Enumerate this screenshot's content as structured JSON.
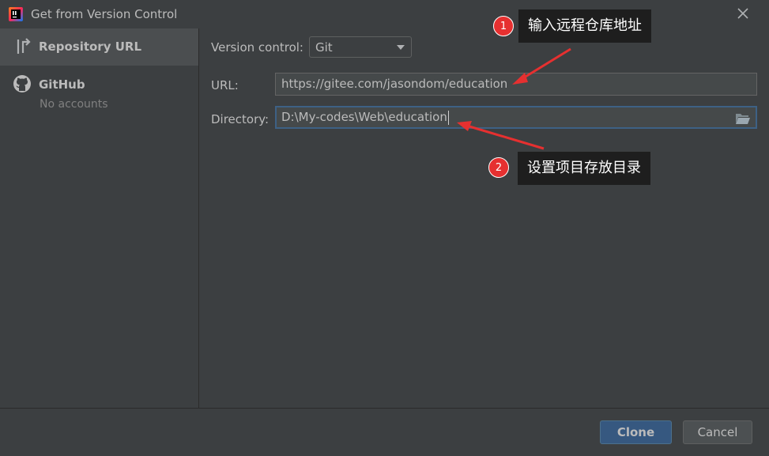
{
  "window": {
    "title": "Get from Version Control"
  },
  "sidebar": {
    "items": [
      {
        "label": "Repository URL"
      },
      {
        "label": "GitHub",
        "sublabel": "No accounts"
      }
    ]
  },
  "form": {
    "version_control_label": "Version control:",
    "version_control_value": "Git",
    "url_label": "URL:",
    "url_value": "https://gitee.com/jasondom/education",
    "directory_label": "Directory:",
    "directory_value": "D:\\My-codes\\Web\\education"
  },
  "buttons": {
    "clone": "Clone",
    "cancel": "Cancel"
  },
  "annotations": [
    {
      "number": "1",
      "text": "输入远程仓库地址"
    },
    {
      "number": "2",
      "text": "设置项目存放目录"
    }
  ],
  "colors": {
    "background": "#3c3f41",
    "selected_item": "#4b4e50",
    "primary_button": "#365880",
    "focus_border": "#3d6185",
    "annotation_red": "#e63030",
    "annotation_box": "#1e1e1e"
  }
}
